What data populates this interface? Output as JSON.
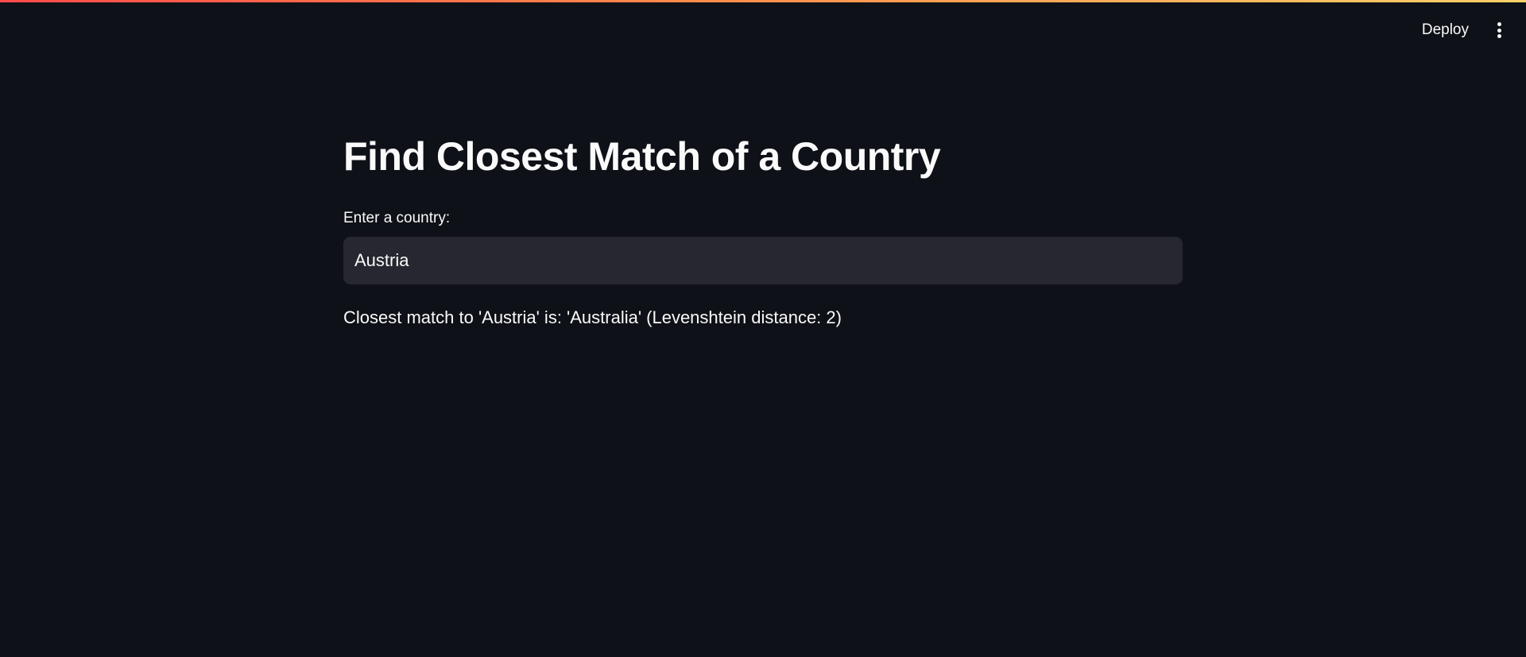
{
  "header": {
    "deploy_label": "Deploy",
    "menu_icon": "kebab-vertical-icon"
  },
  "main": {
    "title": "Find Closest Match of a Country",
    "input": {
      "label": "Enter a country:",
      "value": "Austria"
    },
    "result": "Closest match to 'Austria' is: 'Australia' (Levenshtein distance: 2)"
  },
  "colors": {
    "background": "#0e1117",
    "input_background": "#262730",
    "text": "#fafafa",
    "accent_gradient_start": "#ff4b4b",
    "accent_gradient_end": "#ffd166"
  }
}
